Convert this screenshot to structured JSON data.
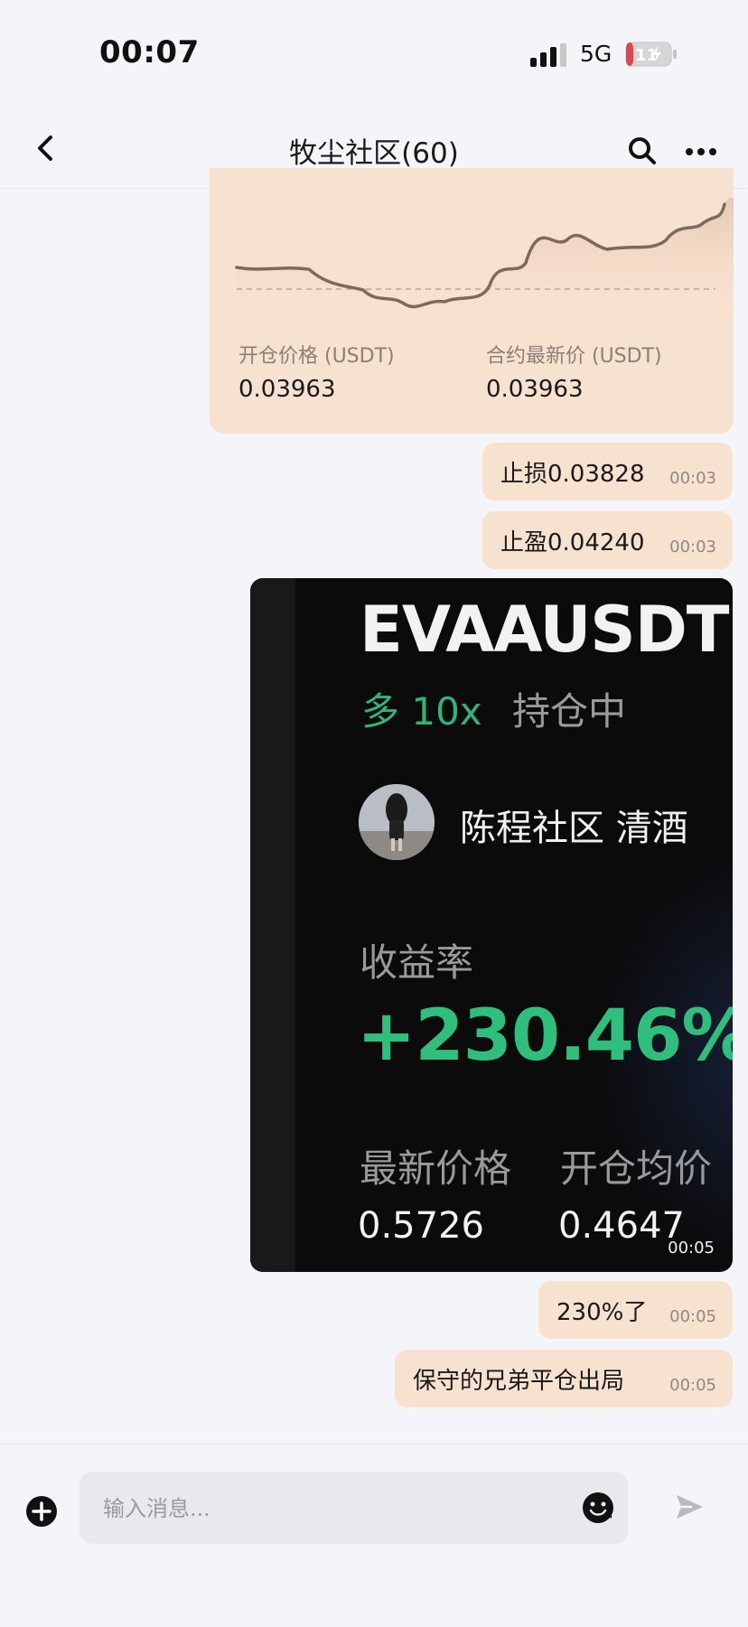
{
  "status_bar": {
    "time": "00:07",
    "network": "5G",
    "battery": "11"
  },
  "header": {
    "title": "牧尘社区(60)"
  },
  "trade_card": {
    "open_price_label": "开仓价格 (USDT)",
    "open_price": "0.03963",
    "latest_price_label": "合约最新价 (USDT)",
    "latest_price": "0.03963"
  },
  "messages": [
    {
      "text": "止损0.03828",
      "time": "00:03"
    },
    {
      "text": "止盈0.04240",
      "time": "00:03"
    },
    {
      "text": "230%了",
      "time": "00:05"
    },
    {
      "text": "保守的兄弟平仓出局",
      "time": "00:05"
    }
  ],
  "image_card": {
    "symbol": "EVAAUSDT",
    "direction": "多 10x",
    "position_status": "持仓中",
    "trader": "陈程社区 清酒",
    "roi_label": "收益率",
    "roi": "+230.46%",
    "latest_price_label": "最新价格",
    "avg_open_label": "开仓均价",
    "latest_price": "0.5726",
    "avg_open": "0.4647",
    "time": "00:05"
  },
  "composer": {
    "placeholder": "输入消息..."
  },
  "colors": {
    "bubble": "#f7e1cf",
    "profit_green": "#2fbf7d",
    "background": "#f4f5f8"
  }
}
